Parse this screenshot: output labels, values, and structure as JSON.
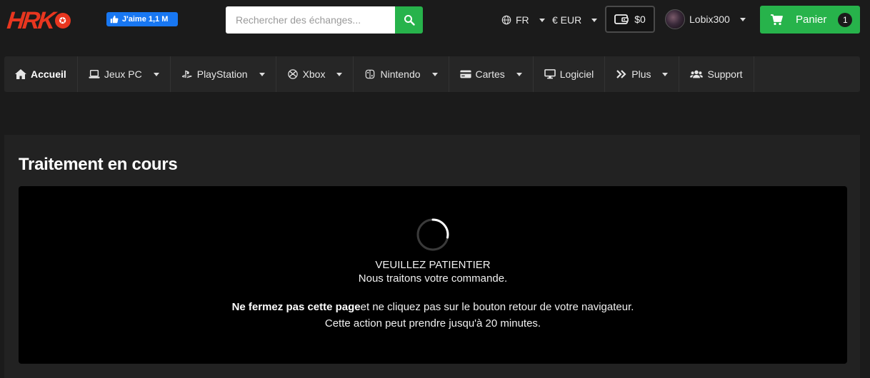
{
  "header": {
    "logo_text": "HRK",
    "fb_like_label": "J'aime 1,1 M",
    "search": {
      "placeholder": "Rechercher des échanges..."
    },
    "language": "FR",
    "currency": "€ EUR",
    "wallet_balance": "$0",
    "username": "Lobix300",
    "cart": {
      "label": "Panier",
      "count": "1"
    }
  },
  "nav": {
    "items": [
      {
        "label": "Accueil",
        "icon": "home-icon",
        "dropdown": false
      },
      {
        "label": "Jeux PC",
        "icon": "laptop-icon",
        "dropdown": true
      },
      {
        "label": "PlayStation",
        "icon": "playstation-icon",
        "dropdown": true
      },
      {
        "label": "Xbox",
        "icon": "xbox-icon",
        "dropdown": true
      },
      {
        "label": "Nintendo",
        "icon": "nintendo-switch-icon",
        "dropdown": true
      },
      {
        "label": "Cartes",
        "icon": "credit-card-icon",
        "dropdown": true
      },
      {
        "label": "Logiciel",
        "icon": "monitor-icon",
        "dropdown": false
      },
      {
        "label": "Plus",
        "icon": "double-chevron-right-icon",
        "dropdown": true
      },
      {
        "label": "Support",
        "icon": "users-icon",
        "dropdown": false
      }
    ]
  },
  "main": {
    "title": "Traitement en cours",
    "status": {
      "heading": "VEUILLEZ PATIENTIER",
      "subheading": "Nous traitons votre commande.",
      "warning_bold": "Ne fermez pas cette page",
      "warning_rest": "et ne cliquez pas sur le bouton retour de votre navigateur.",
      "duration_note": "Cette action peut prendre jusqu'à 20 minutes."
    }
  },
  "colors": {
    "accent_green": "#27b34b",
    "logo_red": "#e8361f",
    "facebook_blue": "#1877f2",
    "background": "#1b1b1b",
    "panel": "#222222",
    "nav": "#262626"
  }
}
